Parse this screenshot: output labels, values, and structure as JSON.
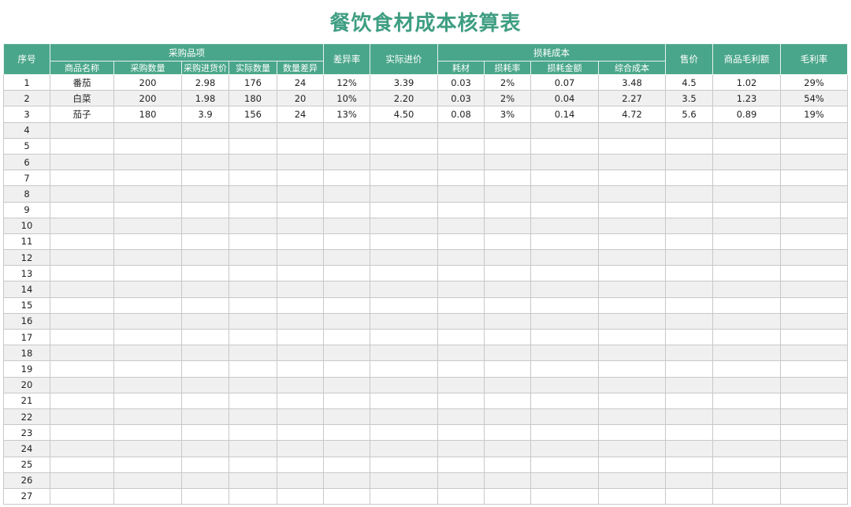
{
  "title": "餐饮食材成本核算表",
  "colors": {
    "header_bg": "#4aa68a",
    "title": "#3f9e82",
    "stripe": "#f0f0f0"
  },
  "headers": {
    "seq": "序号",
    "purchase_group": "采购品项",
    "name": "商品名称",
    "purchase_qty": "采购数量",
    "purchase_price": "采购进货价",
    "actual_qty": "实际数量",
    "qty_diff": "数量差异",
    "diff_rate": "差异率",
    "actual_price": "实际进价",
    "loss_group": "损耗成本",
    "material": "耗材",
    "loss_rate": "损耗率",
    "loss_amount": "损耗金额",
    "total_cost": "综合成本",
    "sale_price": "售价",
    "gross_profit": "商品毛利额",
    "gross_margin": "毛利率"
  },
  "rows": [
    {
      "no": "1",
      "name": "番茄",
      "pqty": "200",
      "pprice": "2.98",
      "aqty": "176",
      "diff": "24",
      "drate": "12%",
      "aprice": "3.39",
      "mat": "0.03",
      "lrate": "2%",
      "lamt": "0.07",
      "tcost": "3.48",
      "sale": "4.5",
      "gp": "1.02",
      "gm": "29%"
    },
    {
      "no": "2",
      "name": "白菜",
      "pqty": "200",
      "pprice": "1.98",
      "aqty": "180",
      "diff": "20",
      "drate": "10%",
      "aprice": "2.20",
      "mat": "0.03",
      "lrate": "2%",
      "lamt": "0.04",
      "tcost": "2.27",
      "sale": "3.5",
      "gp": "1.23",
      "gm": "54%"
    },
    {
      "no": "3",
      "name": "茄子",
      "pqty": "180",
      "pprice": "3.9",
      "aqty": "156",
      "diff": "24",
      "drate": "13%",
      "aprice": "4.50",
      "mat": "0.08",
      "lrate": "3%",
      "lamt": "0.14",
      "tcost": "4.72",
      "sale": "5.6",
      "gp": "0.89",
      "gm": "19%"
    },
    {
      "no": "4"
    },
    {
      "no": "5"
    },
    {
      "no": "6"
    },
    {
      "no": "7"
    },
    {
      "no": "8"
    },
    {
      "no": "9"
    },
    {
      "no": "10"
    },
    {
      "no": "11"
    },
    {
      "no": "12"
    },
    {
      "no": "13"
    },
    {
      "no": "14"
    },
    {
      "no": "15"
    },
    {
      "no": "16"
    },
    {
      "no": "17"
    },
    {
      "no": "18"
    },
    {
      "no": "19"
    },
    {
      "no": "20"
    },
    {
      "no": "21"
    },
    {
      "no": "22"
    },
    {
      "no": "23"
    },
    {
      "no": "24"
    },
    {
      "no": "25"
    },
    {
      "no": "26"
    },
    {
      "no": "27"
    }
  ]
}
